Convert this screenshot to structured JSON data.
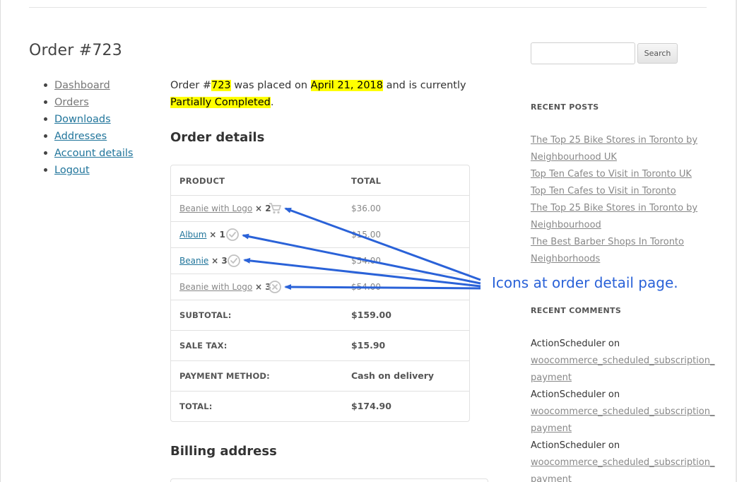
{
  "page": {
    "title": "Order #723"
  },
  "account_nav": [
    {
      "label": "Dashboard"
    },
    {
      "label": "Orders"
    },
    {
      "label": "Downloads"
    },
    {
      "label": "Addresses"
    },
    {
      "label": "Account details"
    },
    {
      "label": "Logout"
    }
  ],
  "order_summary": {
    "prefix": "Order #",
    "order_number": "723",
    "placed_on_text": " was placed on ",
    "date": "April 21, 2018",
    "currently_text": " and is currently",
    "status": "Partially Completed",
    "suffix": "."
  },
  "order_details": {
    "heading": "Order details",
    "columns": {
      "product": "PRODUCT",
      "total": "TOTAL"
    },
    "items": [
      {
        "product": "Beanie with Logo",
        "qty": "× 2",
        "price": "$36.00",
        "status_icon": "shopping-cart-icon"
      },
      {
        "product": "Album",
        "qty": "× 1",
        "price": "$15.00",
        "status_icon": "check-circle-icon"
      },
      {
        "product": "Beanie",
        "qty": "× 3",
        "price": "$54.00",
        "status_icon": "check-circle-icon"
      },
      {
        "product": "Beanie with Logo",
        "qty": "× 3",
        "price": "$54.00",
        "status_icon": "x-circle-icon"
      }
    ],
    "totals": [
      {
        "label": "SUBTOTAL:",
        "value": "$159.00"
      },
      {
        "label": "SALE TAX:",
        "value": "$15.90"
      },
      {
        "label": "PAYMENT METHOD:",
        "value": "Cash on delivery"
      },
      {
        "label": "TOTAL:",
        "value": "$174.90"
      }
    ]
  },
  "billing": {
    "heading": "Billing address"
  },
  "sidebar": {
    "search": {
      "placeholder": "",
      "button_label": "Search"
    },
    "recent_posts": {
      "heading": "RECENT POSTS",
      "lines": [
        "The Top 25 Bike Stores in Toronto by",
        "Neighbourhood UK",
        "Top Ten Cafes to Visit in Toronto UK",
        "Top Ten Cafes to Visit in Toronto",
        "The Top 25 Bike Stores in Toronto by",
        "Neighbourhood",
        "The Best Barber Shops In Toronto",
        "Neighborhoods"
      ]
    },
    "recent_comments": {
      "heading": "RECENT COMMENTS",
      "items": [
        {
          "author": "ActionScheduler",
          "on": " on",
          "link1": "woocommerce_scheduled_subscription_",
          "link2": "payment"
        },
        {
          "author": "ActionScheduler",
          "on": " on",
          "link1": "woocommerce_scheduled_subscription_",
          "link2": "payment"
        },
        {
          "author": "ActionScheduler",
          "on": " on",
          "link1": "woocommerce_scheduled_subscription_",
          "link2": "payment"
        }
      ]
    }
  },
  "annotation": {
    "text": "Icons at order detail page.",
    "color": "#2a62d8"
  },
  "colors": {
    "link": "#21759b",
    "highlight": "#ffff00",
    "muted_link": "#888888"
  }
}
